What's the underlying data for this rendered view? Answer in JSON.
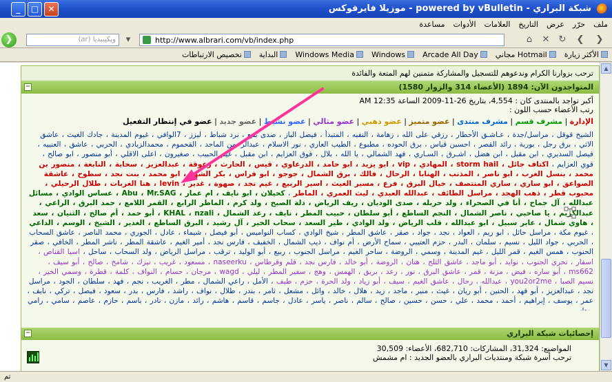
{
  "window": {
    "title": "شبكة البراري - powered by vBulletin - موزيلا فايرفوكس",
    "min_label": "_",
    "max_label": "□",
    "close_label": "✕"
  },
  "menu": [
    "ملف",
    "حرّر",
    "عرض",
    "التاريخ",
    "العلامات",
    "الأدوات",
    "مساعدة"
  ],
  "nav": {
    "search_placeholder": "ويكيبيديا (ar)",
    "url": "http://www.albrari.com/vb/index.php",
    "back": "❯",
    "forward": "❮",
    "reload": "↻",
    "stop": "✕",
    "home": "⌂",
    "go": "❯"
  },
  "bookmarks": [
    "الأكثر زيارة",
    "Hotmail مجاني",
    "Arcade All Day",
    "Windows",
    "Windows Media",
    "البداية",
    "تخصيص الارتباطات"
  ],
  "forum": {
    "welcome": "ترحب بزوارنا الكرام وندعوهم للتسجيل والمشاركة متمنين لهم المتعة والفائدة",
    "online_header": "المتواجدون الآن: 1894 (الأعضاء 314 والزوار 1580)",
    "record": "أكبر تواجد بالمنتدى كان : 4,554، بتاريخ 26-11-2009 الساعة 12:35 AM",
    "new_members": "رتب الأعضاء حسب اللون :",
    "groups": [
      "الإدارة",
      "مشرف قسم",
      "مشرف منتدى",
      "عضو متميز",
      "عضو ذهبي",
      "عضو مثالي",
      "عضو نشيط",
      "عضو جديد",
      "عضو في إنتظار التفعيل"
    ],
    "names_1": "الشيخ قوقل ، مراسل/جدة ، عـاشـق الأحطار ، رزقي على الله ، زهامة ، النفبه ، المتبدأ ، فيصل الباز ، صدى بتبع ، برد شباط ، ليزز ، 7الوافي ، غيوم المدينة ، جادك الغيث ، عاشق الاثي ، برق رجل ، بوربة ، رائد القصر ، احسبن قياس ، برق الحوده ، مطبوع ، الطيب العاري ، نور الاسلام ، عبدالرحمن الماحد ، القحموم ، محمدالزبادي ، الحربي ، عاشق ، العنبيه ، فيصل السديري ، ابن مقبل ، ابن هضل ، اشـرق ، السـاري ، فهد الشمالي ، يا الله ، بلال ، فوق العزايم ، ابن مقبل ، غيم الحبيب ، صغيرون ، اعلى الاقلي ، أبو منصور ، ابو صالح ، قوي العزايم",
    "names_2": "اكتاف جائل ، storm hail ، المهادي ، vip ، ابو يزيد ، ابو حامد ، الدرعاوي ، قيس ، الحارث ، زعوقة ، عبدالعزيز ، سحابة ، النابغة ، منصور بن محمد ، بنسل الغرب ، ابو ناصر ، المذنب ، الهنابا ، الرحال ، فالك ، برق الشمال ، جوجو ، ابو فراس ، بكر الشهد ، ابو محمد ، بنت نجد ، سطوح ، عاشقة الصواعق ، ابو ساري ، ساري المنتصف ، خيال البرق ، فرع ، مسير الغيث ، اسير الربيع ، غيم نجد ، صهوة ، غدير ، levin ، هنا الغربات ، طلال الرحيلي ، محبوب قطر ، ذهب الهجد ، مراسل الطائف ، عبدالله العبدي ، ليث العمري ، الماطر",
    "names_3": "كحيلان ، ابو نايف ، ام عمار ، Abu ، Mr.SAG ، عساس الوادي ، مسائل عبدالله ، آل جماح ، أنا في الصحراء ، ولد حربله ، صدى الوديان ، ريف الرياض ، دلة الصبح ، ولد كرم ، الماطر الرابع ، القمر اللامع ، حمد البرق ، الراعي ، عبدالكريم ، يا صاحبي ، ناصر الشمال ، النجم الساطع ، أبو سلطان ، حبيب المطر ، نايف ، رعد الشمال ، KHAL ، nzali ، أبو حمد ، أم صالح ، الثنيان ، سعد ، هاوي شمال ، عابر سبيل ، ابو عبدالله ، قلب الرياض ، ولد الوادي ، طير السعد ، سحاب الخير ، آل رشيد ، البرق الساطع ، الغدير ، الشيخ ، الوسم ، الداعي",
    "names_4": "غيوم مكة ، مراسل حائل ، ابو ريم ، العواد ، نجد ، جواد ، صقر ، عاشق المطر ، شيخ الوادي ، كساب النواميس ، أبو فيصل ، شيماء ، عادل ، الجوري ، محمد الناصر ، عاشق السحاب ، الحربي ، جواد الليل ، نسيم ، سلمان ، البدر ، حزم العتيبي ، سماح الأرض ، أم نواف ، ذيب الشمال ، الخفيف ، فارس نجد ، أمير الغيم ، عاشقة المطر ، ناشر المطر ، الخافي ، صقر الحنوب ، همس الغيم ، قمر الليل ، غيم المدينة ، وسمي ، الروضة ، ساحر الغيم ، مراسل الجنوب ، ربيع ، أبو الوليد ، ترقب ، مراسل الرياض ، ولد السحاب ، ساحل",
    "names_5": "اسيا القناص ، اسفار ، تحري الجنوب ، نوايد ، أبو ماجد ، عاشق الثلج ، هتان ، الروضة ، أبو خالد ، فارس نجد ، قلم وقرطاس ، naseerku ، مسعود ، غريب ، نيزك ، شامخ ، صالح ، أبو سيف ، ms662 ، أبو ساره ، فيض ، مزنة ، قمر ، عاشق البرق ، نور ، رعد ، بريق ، الهمس ، وهج ، سفير المطر ، ليلي ، wagd ، مرجان ، حسام ، النواف ، كلمة ، قطرة ، وسمي الخير ، نسيم الصبا ، you2or2me ، عبدالله ، رحال ، عاشق الغيم ، سيف ، أبو زياد ، ولد الحرة ، حزم ، طيف",
    "names_6": "الأمل ، راعي الشمال ، مطر ، الغريب ، نجم ، فهد ، سلطان ، الجود ، مراسل نجد ، عبدالعزيز ، أبو فهد ، الحنين ، أبو ريان ، غيث ، منير ، ماجد ، زيد ، هلال ، خالد ، وائل ، مشعل ، ثامر ، بندر ، طلال ، نواف ، راشد ، فارس ، بدر ، سعود ، فيصل ، تركي ، نايف ، عمر ، يوسف ، إبراهيم ، أحمد ، محمد ، علي ، حسن ، حسين ، صالح ، سالم ، ناصر ، ياسر ، عادل ، جاسم ، قاسم ، هاشم ، رائد ، مازن ، نادر ، باسم ، حازم ، عاصم ، سامي ، رامي ، هاني",
    "stats_header": "إحصائيات شبكة البراري",
    "stats_line1": "المواضيع: 31,324، المشاركات: 682,710، الأعضاء: 30,509",
    "stats_line2": "ترحب أسرة شبكة ومنتديات البراري بالعضو الجديد : ام مشمش"
  },
  "status": "تم",
  "colors": {
    "header_green": "#8cbc44",
    "arrow": "#ff3399",
    "link_blue": "#003399"
  }
}
